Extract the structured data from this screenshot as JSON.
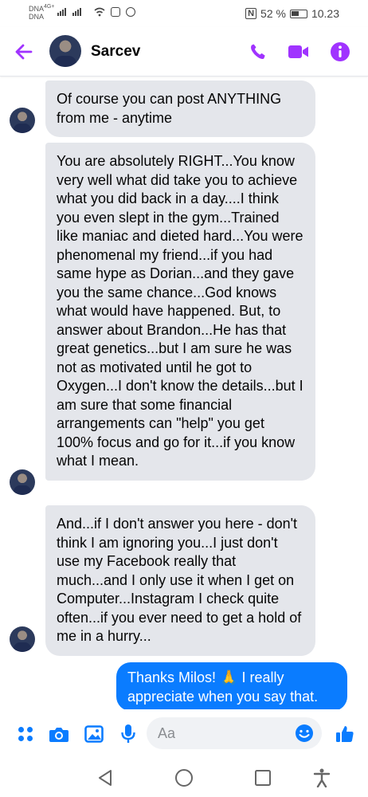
{
  "status_bar": {
    "carrier_top": "DNA",
    "carrier_top_tech": "4G+",
    "carrier_bottom": "DNA",
    "battery": "52 %",
    "time": "10.23"
  },
  "header": {
    "contact_name": "Sarcev",
    "icons": [
      "back-arrow-icon",
      "phone-icon",
      "video-icon",
      "info-icon"
    ],
    "accent_color": "#a033ff"
  },
  "messages": [
    {
      "direction": "incoming",
      "text": "Of course you can post ANYTHING from me - anytime"
    },
    {
      "direction": "incoming",
      "text": "You are absolutely RIGHT...You know very well what did take you to achieve what you did back in a day....I think you even slept in the gym...Trained like maniac and dieted hard...You were phenomenal my friend...if you had same hype as Dorian...and they gave you the same chance...God knows what would have happened. But, to answer about Brandon...He has that great genetics...but I am sure he was not as motivated until he got to Oxygen...I don't know the details...but I am sure that some financial arrangements can \"help\" you get 100% focus and go for it...if you know what I mean."
    },
    {
      "direction": "incoming",
      "text": "And...if I don't answer you here - don't think I am ignoring you...I just don't use my Facebook really that much...and I only use it when I get on Computer...Instagram I check quite often...if you ever need to get a hold of me in a hurry..."
    },
    {
      "direction": "outgoing",
      "text": "Thanks Milos! 🙏 I really appreciate when you say that."
    }
  ],
  "composer": {
    "placeholder": "Aa",
    "icons": [
      "menu-dots-icon",
      "camera-icon",
      "image-icon",
      "microphone-icon",
      "emoji-icon",
      "thumbs-up-icon"
    ],
    "accent_color": "#0a7cff"
  },
  "navbar": {
    "icons": [
      "back-triangle-icon",
      "home-circle-icon",
      "recents-square-icon",
      "accessibility-icon"
    ]
  }
}
